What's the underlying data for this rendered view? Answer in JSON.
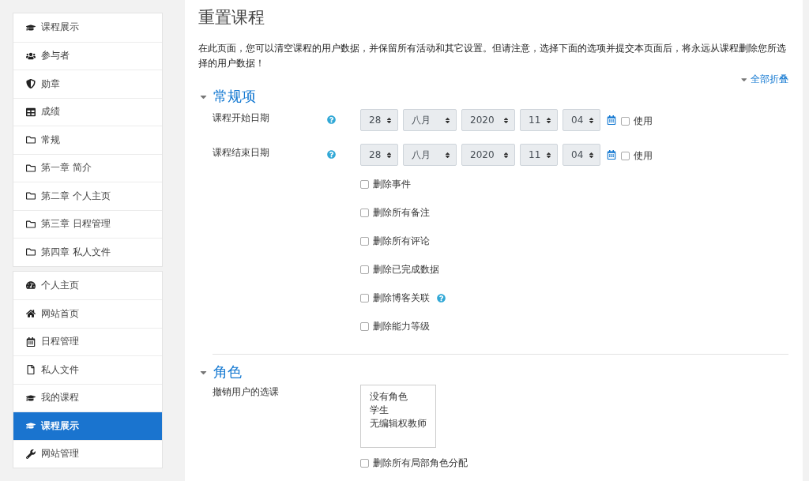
{
  "sidebar": {
    "groups": [
      {
        "items": [
          {
            "label": "课程展示",
            "kind": "course",
            "selected": false
          },
          {
            "label": "参与者",
            "kind": "users",
            "selected": false
          },
          {
            "label": "勋章",
            "kind": "badge",
            "selected": false
          },
          {
            "label": "成绩",
            "kind": "table",
            "selected": false
          },
          {
            "label": "常规",
            "kind": "folder",
            "selected": false
          },
          {
            "label": "第一章 简介",
            "kind": "folder",
            "selected": false
          },
          {
            "label": "第二章 个人主页",
            "kind": "folder",
            "selected": false
          },
          {
            "label": "第三章 日程管理",
            "kind": "folder",
            "selected": false
          },
          {
            "label": "第四章 私人文件",
            "kind": "folder",
            "selected": false
          }
        ]
      },
      {
        "items": [
          {
            "label": "个人主页",
            "kind": "dashboard",
            "selected": false
          },
          {
            "label": "网站首页",
            "kind": "home",
            "selected": false
          },
          {
            "label": "日程管理",
            "kind": "calendar",
            "selected": false
          },
          {
            "label": "私人文件",
            "kind": "file",
            "selected": false
          },
          {
            "label": "我的课程",
            "kind": "course",
            "selected": false
          },
          {
            "label": "课程展示",
            "kind": "course",
            "selected": true
          },
          {
            "label": "网站管理",
            "kind": "wrench",
            "selected": false
          }
        ]
      }
    ]
  },
  "main": {
    "title": "重置课程",
    "intro": "在此页面，您可以清空课程的用户数据，并保留所有活动和其它设置。但请注意，选择下面的选项并提交本页面后，将永远从课程删除您所选择的用户数据！",
    "collapse_all": "全部折叠",
    "sections": [
      {
        "heading": "常规项",
        "expanded": true,
        "rows": [
          {
            "kind": "date",
            "label": "课程开始日期",
            "help": true,
            "fields": [
              "28",
              "八月",
              "2020",
              "11",
              "04"
            ],
            "enable": {
              "label": "使用",
              "checked": false
            }
          },
          {
            "kind": "date",
            "label": "课程结束日期",
            "help": true,
            "fields": [
              "28",
              "八月",
              "2020",
              "11",
              "04"
            ],
            "enable": {
              "label": "使用",
              "checked": false
            }
          },
          {
            "kind": "checkbox",
            "label": "删除事件",
            "checked": false,
            "help": false
          },
          {
            "kind": "checkbox",
            "label": "删除所有备注",
            "checked": false,
            "help": false
          },
          {
            "kind": "checkbox",
            "label": "删除所有评论",
            "checked": false,
            "help": false
          },
          {
            "kind": "checkbox",
            "label": "删除已完成数据",
            "checked": false,
            "help": false
          },
          {
            "kind": "checkbox",
            "label": "删除博客关联",
            "checked": false,
            "help": true
          },
          {
            "kind": "checkbox",
            "label": "删除能力等级",
            "checked": false,
            "help": false
          }
        ]
      },
      {
        "heading": "角色",
        "expanded": true,
        "rows": [
          {
            "kind": "listbox",
            "label": "撤销用户的选课",
            "options": [
              {
                "label": "没有角色",
                "selected": false
              },
              {
                "label": "学生",
                "selected": false
              },
              {
                "label": "无编辑权教师",
                "selected": false
              }
            ]
          },
          {
            "kind": "checkbox",
            "label": "删除所有局部角色分配",
            "checked": false,
            "help": false
          }
        ]
      }
    ]
  }
}
